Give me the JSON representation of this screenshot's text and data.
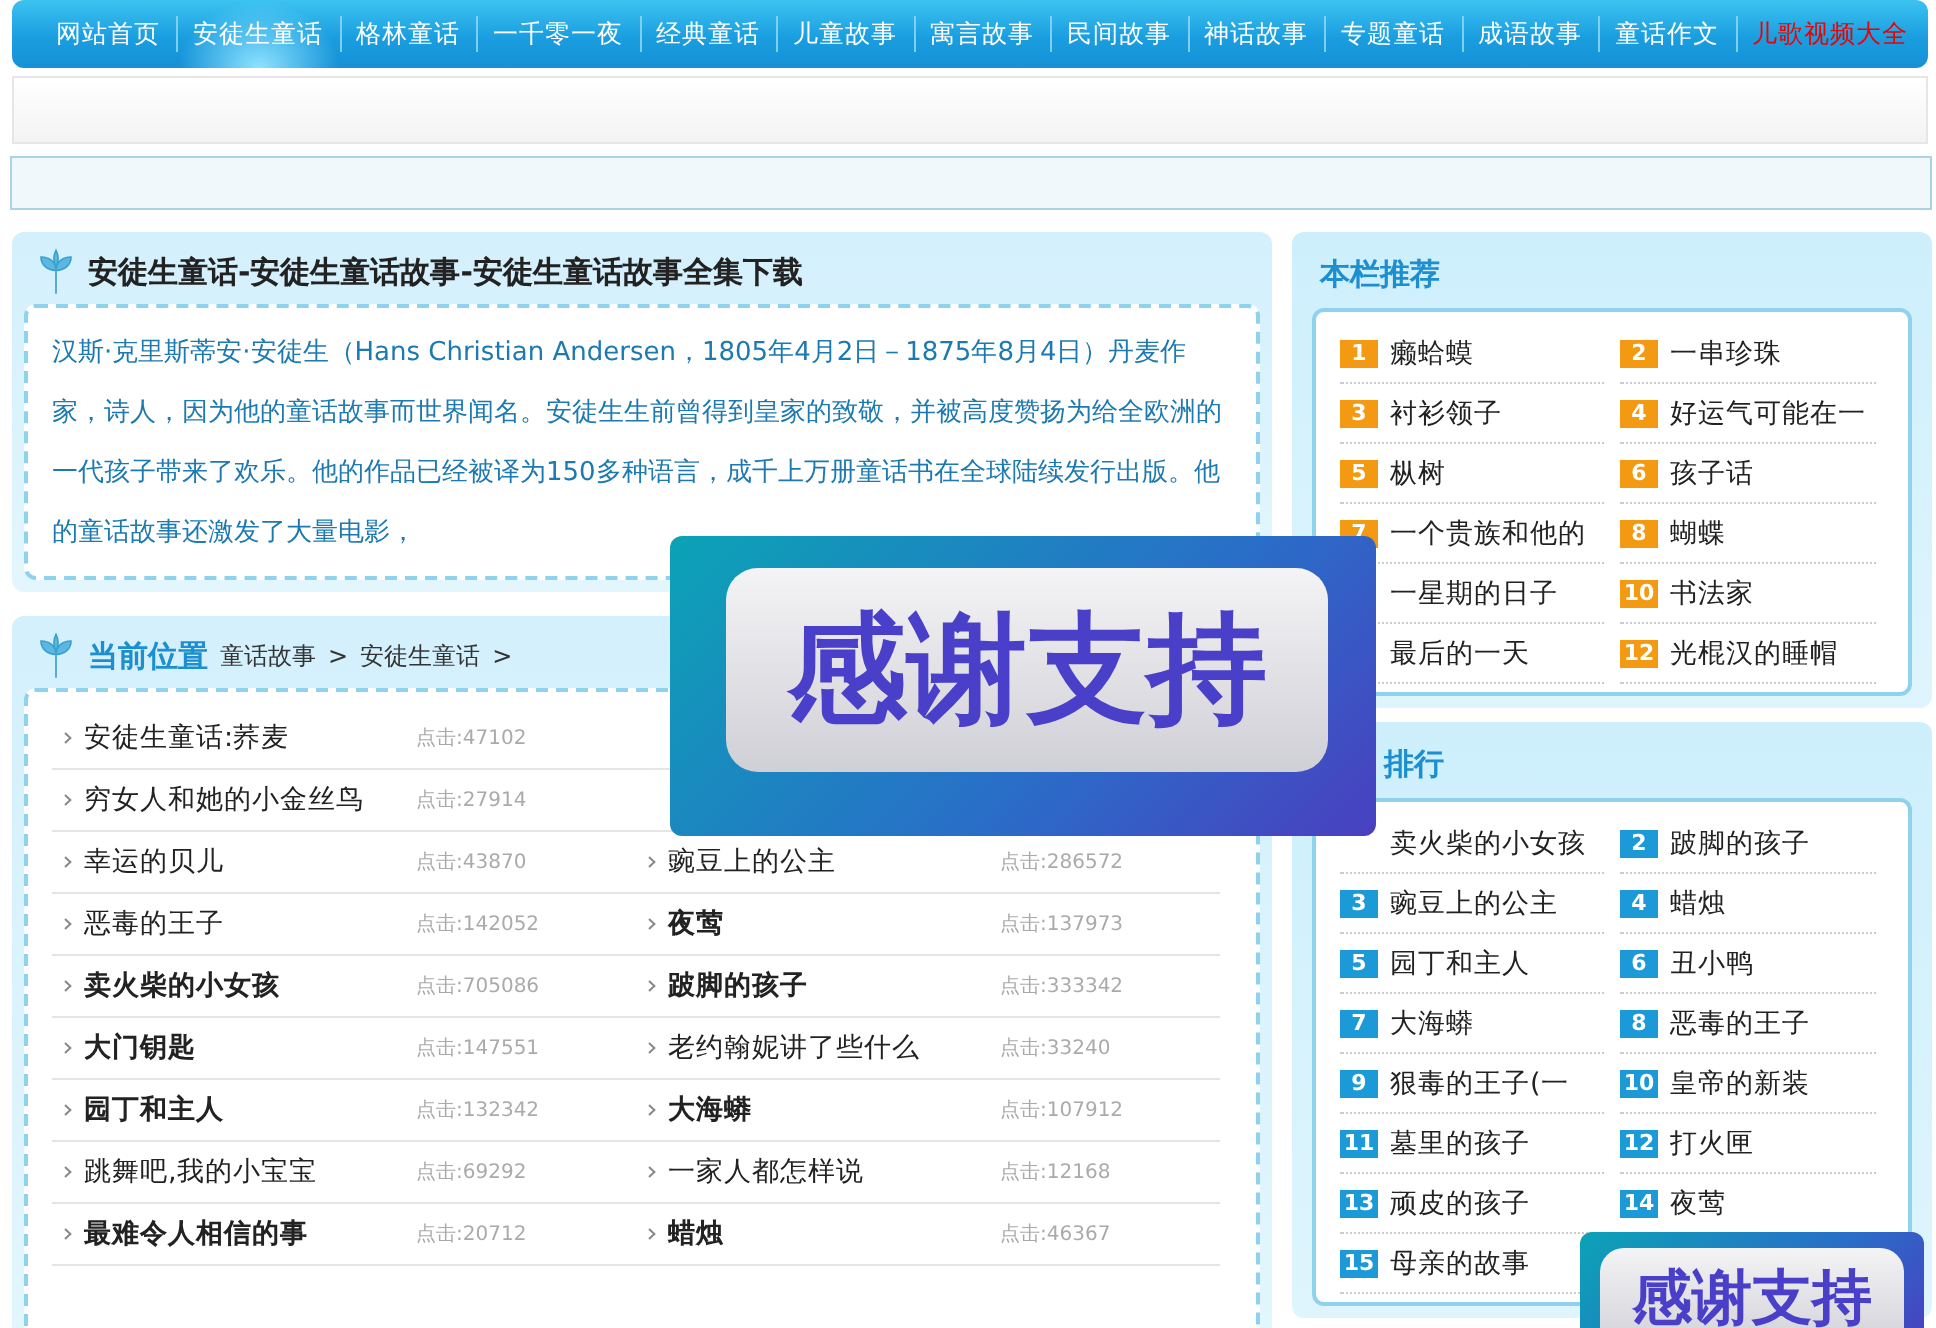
{
  "nav": [
    {
      "label": "网站首页",
      "selected": false,
      "highlight": false
    },
    {
      "label": "安徒生童话",
      "selected": true,
      "highlight": false
    },
    {
      "label": "格林童话",
      "selected": false,
      "highlight": false
    },
    {
      "label": "一千零一夜",
      "selected": false,
      "highlight": false
    },
    {
      "label": "经典童话",
      "selected": false,
      "highlight": false
    },
    {
      "label": "儿童故事",
      "selected": false,
      "highlight": false
    },
    {
      "label": "寓言故事",
      "selected": false,
      "highlight": false
    },
    {
      "label": "民间故事",
      "selected": false,
      "highlight": false
    },
    {
      "label": "神话故事",
      "selected": false,
      "highlight": false
    },
    {
      "label": "专题童话",
      "selected": false,
      "highlight": false
    },
    {
      "label": "成语故事",
      "selected": false,
      "highlight": false
    },
    {
      "label": "童话作文",
      "selected": false,
      "highlight": false
    },
    {
      "label": "儿歌视频大全",
      "selected": false,
      "highlight": true
    }
  ],
  "intro": {
    "title": "安徒生童话-安徒生童话故事-安徒生童话故事全集下载",
    "text": "汉斯·克里斯蒂安·安徒生（Hans Christian Andersen，1805年4月2日－1875年8月4日）丹麦作家，诗人，因为他的童话故事而世界闻名。安徒生生前曾得到皇家的致敬，并被高度赞扬为给全欧洲的一代孩子带来了欢乐。他的作品已经被译为150多种语言，成千上万册童话书在全球陆续发行出版。他的童话故事还激发了大量电影，"
  },
  "breadcrumb": {
    "label": "当前位置",
    "path": [
      {
        "text": "童话故事"
      },
      {
        "text": "安徒生童话"
      }
    ],
    "separator": ">"
  },
  "stories": [
    {
      "left": {
        "title": "安徒生童话:荞麦",
        "hits": "点击:47102",
        "bold": false
      }
    },
    {
      "left": {
        "title": "穷女人和她的小金丝鸟",
        "hits": "点击:27914",
        "bold": false
      }
    },
    {
      "left": {
        "title": "幸运的贝儿",
        "hits": "点击:43870",
        "bold": false
      },
      "right": {
        "title": "豌豆上的公主",
        "hits": "点击:286572",
        "bold": false
      }
    },
    {
      "left": {
        "title": "恶毒的王子",
        "hits": "点击:142052",
        "bold": false
      },
      "right": {
        "title": "夜莺",
        "hits": "点击:137973",
        "bold": true
      }
    },
    {
      "left": {
        "title": "卖火柴的小女孩",
        "hits": "点击:705086",
        "bold": true
      },
      "right": {
        "title": "跛脚的孩子",
        "hits": "点击:333342",
        "bold": true
      }
    },
    {
      "left": {
        "title": "大门钥匙",
        "hits": "点击:147551",
        "bold": true
      },
      "right": {
        "title": "老约翰妮讲了些什么",
        "hits": "点击:33240",
        "bold": false
      }
    },
    {
      "left": {
        "title": "园丁和主人",
        "hits": "点击:132342",
        "bold": true
      },
      "right": {
        "title": "大海蟒",
        "hits": "点击:107912",
        "bold": true
      }
    },
    {
      "left": {
        "title": "跳舞吧,我的小宝宝",
        "hits": "点击:69292",
        "bold": false
      },
      "right": {
        "title": "一家人都怎样说",
        "hits": "点击:12168",
        "bold": false
      }
    },
    {
      "left": {
        "title": "最难令人相信的事",
        "hits": "点击:20712",
        "bold": true
      },
      "right": {
        "title": "蜡烛",
        "hits": "点击:46367",
        "bold": true
      }
    }
  ],
  "recommend": {
    "title": "本栏推荐",
    "items": [
      {
        "rank": "1",
        "title": "癞蛤蟆"
      },
      {
        "rank": "2",
        "title": "一串珍珠"
      },
      {
        "rank": "3",
        "title": "衬衫领子"
      },
      {
        "rank": "4",
        "title": "好运气可能在一"
      },
      {
        "rank": "5",
        "title": "枞树"
      },
      {
        "rank": "6",
        "title": "孩子话"
      },
      {
        "rank": "7",
        "title": "一个贵族和他的"
      },
      {
        "rank": "8",
        "title": "蝴蝶"
      },
      {
        "title": "一星期的日子"
      },
      {
        "rank": "10",
        "title": "书法家"
      },
      {
        "title": "最后的一天"
      },
      {
        "rank": "12",
        "title": "光棍汉的睡帽"
      }
    ]
  },
  "ranking": {
    "title": "排行",
    "items": [
      {
        "title": "卖火柴的小女孩"
      },
      {
        "rank": "2",
        "title": "跛脚的孩子"
      },
      {
        "rank": "3",
        "title": "豌豆上的公主"
      },
      {
        "rank": "4",
        "title": "蜡烛"
      },
      {
        "rank": "5",
        "title": "园丁和主人"
      },
      {
        "rank": "6",
        "title": "丑小鸭"
      },
      {
        "rank": "7",
        "title": "大海蟒"
      },
      {
        "rank": "8",
        "title": "恶毒的王子"
      },
      {
        "rank": "9",
        "title": "狠毒的王子(一"
      },
      {
        "rank": "10",
        "title": "皇帝的新装"
      },
      {
        "rank": "11",
        "title": "墓里的孩子"
      },
      {
        "rank": "12",
        "title": "打火匣"
      },
      {
        "rank": "13",
        "title": "顽皮的孩子"
      },
      {
        "rank": "14",
        "title": "夜莺"
      },
      {
        "rank": "15",
        "title": "母亲的故事"
      }
    ]
  },
  "popups": [
    {
      "text": "感谢支持"
    },
    {
      "text": "感谢支持"
    }
  ]
}
